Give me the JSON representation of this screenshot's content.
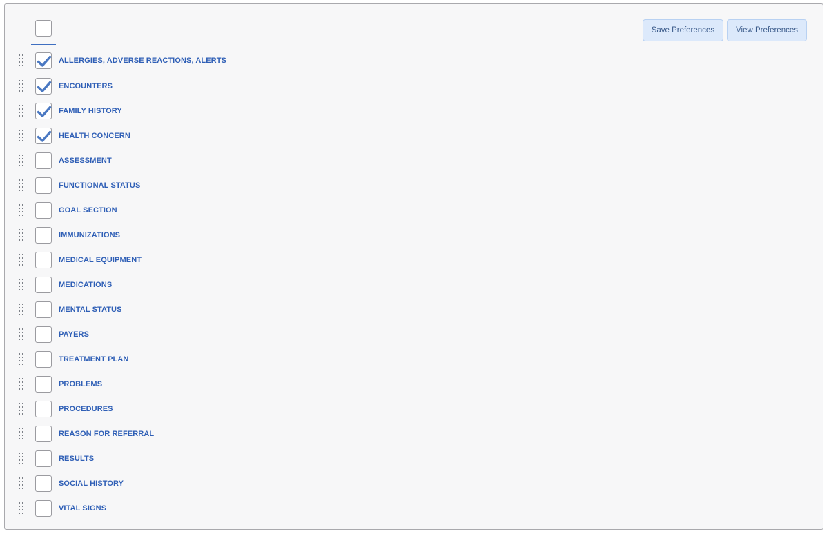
{
  "header": {
    "select_all_checked": false
  },
  "actions": {
    "save_label": "Save Preferences",
    "view_label": "View Preferences"
  },
  "colors": {
    "label": "#2f5fb6",
    "check": "#4a78c2",
    "button_bg": "#dce9fb"
  },
  "sections": [
    {
      "label": "ALLERGIES, ADVERSE REACTIONS, ALERTS",
      "checked": true
    },
    {
      "label": "ENCOUNTERS",
      "checked": true
    },
    {
      "label": "FAMILY HISTORY",
      "checked": true
    },
    {
      "label": "HEALTH CONCERN",
      "checked": true
    },
    {
      "label": "ASSESSMENT",
      "checked": false
    },
    {
      "label": "FUNCTIONAL STATUS",
      "checked": false
    },
    {
      "label": "GOAL SECTION",
      "checked": false
    },
    {
      "label": "IMMUNIZATIONS",
      "checked": false
    },
    {
      "label": "MEDICAL EQUIPMENT",
      "checked": false
    },
    {
      "label": "MEDICATIONS",
      "checked": false
    },
    {
      "label": "MENTAL STATUS",
      "checked": false
    },
    {
      "label": "PAYERS",
      "checked": false
    },
    {
      "label": "TREATMENT PLAN",
      "checked": false
    },
    {
      "label": "PROBLEMS",
      "checked": false
    },
    {
      "label": "PROCEDURES",
      "checked": false
    },
    {
      "label": "REASON FOR REFERRAL",
      "checked": false
    },
    {
      "label": "RESULTS",
      "checked": false
    },
    {
      "label": "SOCIAL HISTORY",
      "checked": false
    },
    {
      "label": "VITAL SIGNS",
      "checked": false
    }
  ]
}
